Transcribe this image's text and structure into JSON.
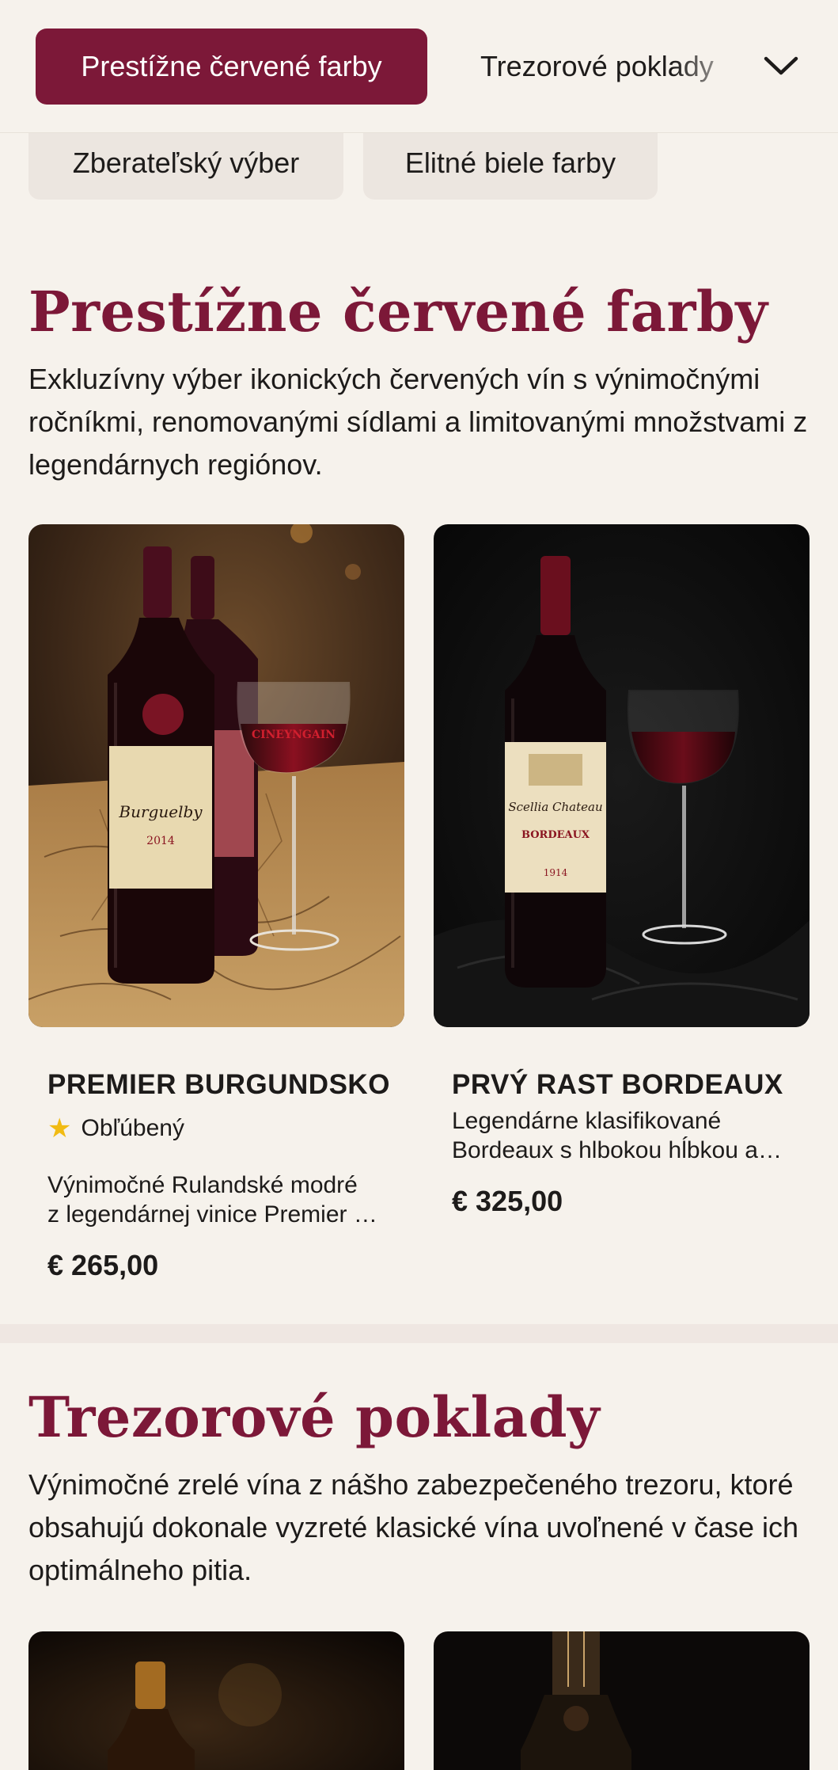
{
  "category_nav": {
    "active": "Prestížne červené farby",
    "next": "Trezorové poklady",
    "pills": [
      "Zberateľský výber",
      "Elitné biele farby"
    ],
    "toggle_icon": "chevron-down-icon"
  },
  "sections": [
    {
      "title": "Prestížne červené farby",
      "description": "Exkluzívny výber ikonických červených vín s výnimočnými ročníkmi, renomovanými sídlami a limitovanými množstvami z legendárnych regiónov.",
      "products": [
        {
          "name": "PREMIER BURGUNDSKO",
          "badge": "Obľúbený",
          "badge_icon": "star-icon",
          "desc_line1": "Výnimočné Rulandské modré",
          "desc_line2": "z legendárnej vinice Premier Cru",
          "price": "€ 265,00",
          "image_label_wine": "Burguelby",
          "image_label_vintage": "2014",
          "image_glass_text": "CINEYNGAIN"
        },
        {
          "name": "PRVÝ RAST BORDEAUX",
          "desc_line1": "Legendárne klasifikované",
          "desc_line2": "Bordeaux s hlbokou hĺbkou a štruktúrou",
          "price": "€ 325,00",
          "image_label_wine": "Scellia Chateau",
          "image_label_region": "BORDEAUX",
          "image_label_vintage": "1914"
        }
      ]
    },
    {
      "title": "Trezorové poklady",
      "description": "Výnimočné zrelé vína z nášho zabezpečeného trezoru, ktoré obsahujú dokonale vyzreté klasické vína uvoľnené v čase ich optimálneho pitia."
    }
  ],
  "colors": {
    "accent": "#7c1838",
    "background": "#f6f2ec",
    "pill": "#ece6e0",
    "star": "#f1bb13"
  }
}
